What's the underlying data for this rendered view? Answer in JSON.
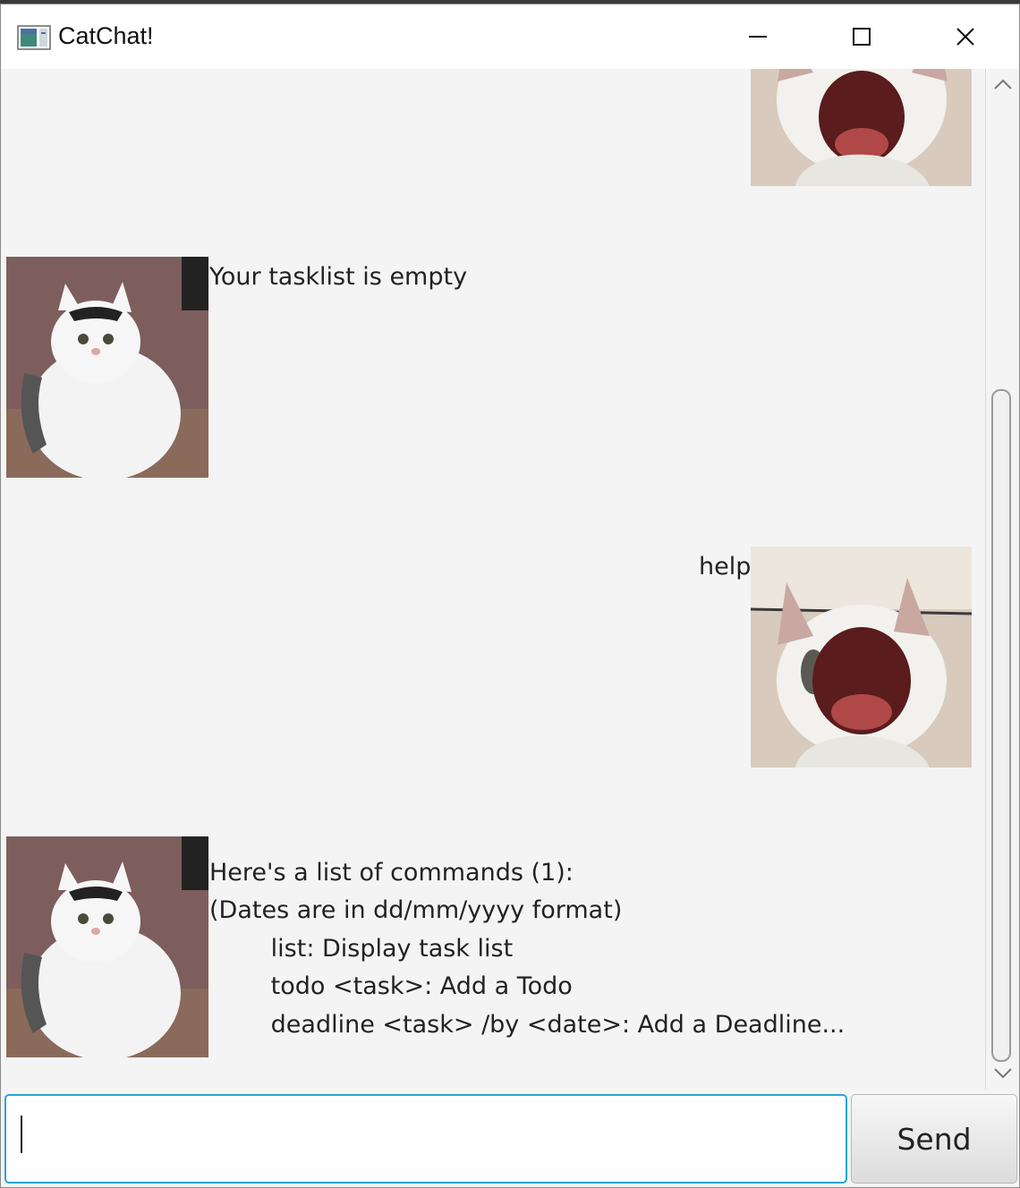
{
  "window": {
    "title": "CatChat!"
  },
  "messages": [
    {
      "sender": "user",
      "text": ""
    },
    {
      "sender": "bot",
      "text": "Your tasklist is empty"
    },
    {
      "sender": "user",
      "text": "help"
    },
    {
      "sender": "bot",
      "lines": [
        "Here's a list of commands (1):",
        "(Dates are in dd/mm/yyyy format)",
        "        list: Display task list",
        "        todo <task>: Add a Todo",
        "        deadline <task> /by <date>: Add a Deadline..."
      ]
    }
  ],
  "input": {
    "value": "",
    "placeholder": ""
  },
  "send": {
    "label": "Send"
  },
  "icons": {
    "app": "app-window-icon",
    "minimize": "minimize-icon",
    "maximize": "maximize-icon",
    "close": "close-icon",
    "scroll_up": "chevron-up-icon",
    "scroll_down": "chevron-down-icon"
  },
  "colors": {
    "input_focus": "#2aa3d4",
    "background": "#f4f4f4"
  }
}
